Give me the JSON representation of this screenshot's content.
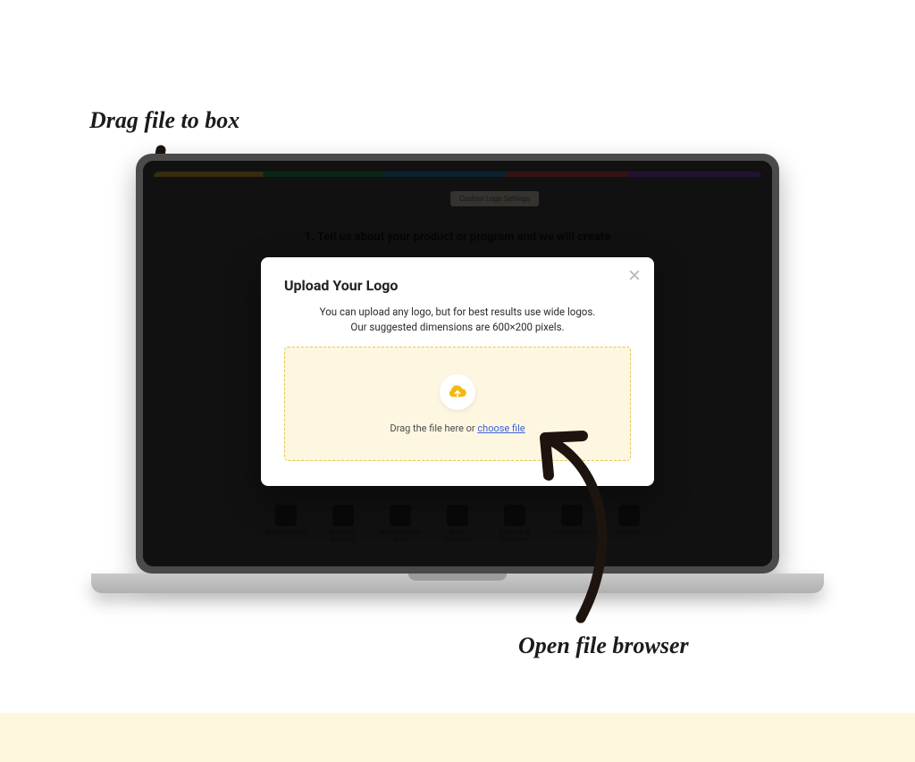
{
  "annotations": {
    "top": "Drag file to box",
    "bottom": "Open file browser"
  },
  "background_app": {
    "chip": "Custom Logo Settings",
    "heading": "1. Tell us about your product or program and we will create",
    "tiles": [
      "Social Content",
      "Business Branding",
      "Website and/or Blog",
      "Email Marketing",
      "Products & Programs",
      "Video Scripts",
      "Captions"
    ]
  },
  "modal": {
    "title": "Upload Your Logo",
    "subtitle_line1": "You can upload any logo, but for best results use wide logos.",
    "subtitle_line2": "Our suggested dimensions are 600×200 pixels.",
    "drop_prefix": "Drag the file here or ",
    "choose_label": "choose file"
  }
}
